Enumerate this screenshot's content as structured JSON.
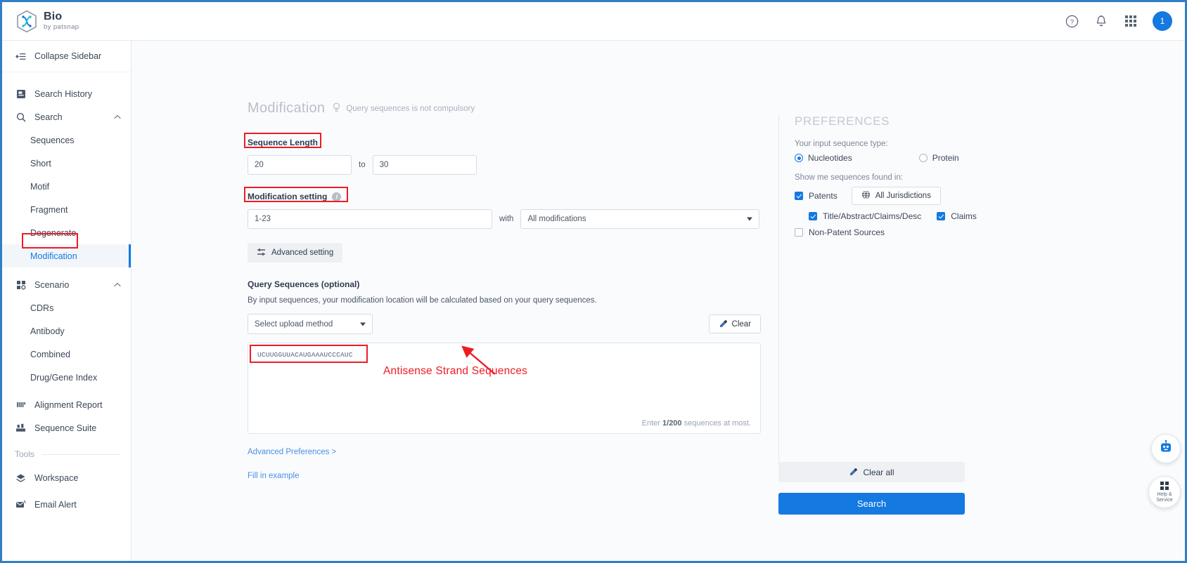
{
  "brand": {
    "title": "Bio",
    "subtitle": "by patsnap"
  },
  "topbar": {
    "help_icon": "question-circle-icon",
    "bell_icon": "bell-icon",
    "apps_icon": "grid-apps-icon",
    "avatar_text": "1"
  },
  "sidebar": {
    "collapse_label": "Collapse Sidebar",
    "items": [
      {
        "label": "Search History",
        "icon": "history-icon"
      },
      {
        "label": "Search",
        "icon": "search-icon",
        "chevron": "⌃"
      },
      {
        "label": "Sequences"
      },
      {
        "label": "Short"
      },
      {
        "label": "Motif"
      },
      {
        "label": "Fragment"
      },
      {
        "label": "Degenerate"
      },
      {
        "label": "Modification"
      },
      {
        "label": "Scenario",
        "icon": "scenario-icon",
        "chevron": "⌃"
      },
      {
        "label": "CDRs"
      },
      {
        "label": "Antibody"
      },
      {
        "label": "Combined"
      },
      {
        "label": "Drug/Gene Index"
      },
      {
        "label": "Alignment Report",
        "icon": "alignment-icon"
      },
      {
        "label": "Sequence Suite",
        "icon": "suite-icon"
      }
    ],
    "tools_label": "Tools",
    "tools": [
      {
        "label": "Workspace",
        "icon": "workspace-icon"
      },
      {
        "label": "Email Alert",
        "icon": "email-alert-icon"
      }
    ]
  },
  "form": {
    "page_title": "Modification",
    "hint_text": "Query sequences is not compulsory",
    "hint_icon": "lightbulb-icon",
    "sequence_length": {
      "label": "Sequence Length",
      "from_value": "20",
      "to_label": "to",
      "to_value": "30"
    },
    "modification_setting": {
      "label": "Modification setting",
      "info_icon": "info-icon",
      "range_value": "1-23",
      "with_label": "with",
      "modification_type": "All modifications"
    },
    "advanced_setting_button": "Advanced setting",
    "advanced_setting_icon": "sliders-icon",
    "query_sequences": {
      "heading": "Query Sequences (optional)",
      "description": "By input sequences, your modification location will be calculated based on your query sequences.",
      "upload_method": "Select upload method",
      "clear_button": "Clear",
      "clear_icon": "eraser-icon",
      "sequence_text": "UCUUGGUUACAUGAAAUCCCAUC",
      "counter_prefix": "Enter ",
      "counter_value": "1/200",
      "counter_suffix": " sequences at most."
    },
    "advanced_preferences_link": "Advanced Preferences >",
    "fill_example_link": "Fill in example"
  },
  "annotations": {
    "caption": "Antisense Strand Sequences",
    "color": "#ee1c24"
  },
  "preferences": {
    "title": "PREFERENCES",
    "input_type_label": "Your input sequence type:",
    "input_types": [
      {
        "label": "Nucleotides",
        "selected": true
      },
      {
        "label": "Protein",
        "selected": false
      }
    ],
    "found_in_label": "Show me sequences found in:",
    "patents": {
      "label": "Patents",
      "checked": true
    },
    "jurisdictions_button": "All Jurisdictions",
    "jurisdictions_icon": "globe-icon",
    "sub_options": [
      {
        "label": "Title/Abstract/Claims/Desc",
        "checked": true
      },
      {
        "label": "Claims",
        "checked": true
      }
    ],
    "non_patent": {
      "label": "Non-Patent Sources",
      "checked": false
    },
    "clear_all_button": "Clear all",
    "clear_all_icon": "eraser-icon",
    "search_button": "Search"
  },
  "floating": {
    "chat_icon": "chat-robot-icon",
    "help_icon": "help-grid-icon",
    "help_line1": "Help &",
    "help_line2": "Service"
  },
  "colors": {
    "accent": "#1479e0",
    "annotation": "#ee1c24",
    "link": "#4a90e2"
  }
}
